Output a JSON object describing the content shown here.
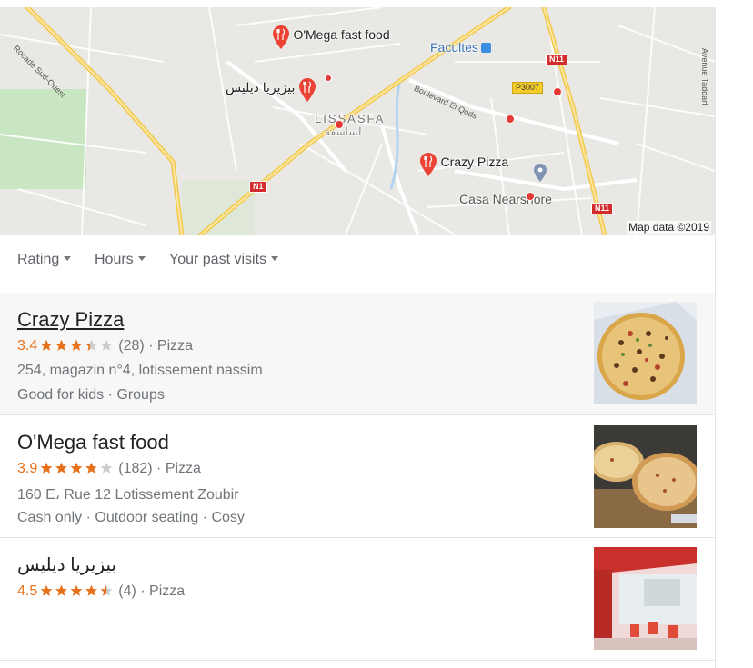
{
  "map": {
    "places": [
      {
        "name": "O'Mega fast food"
      },
      {
        "name": "بيزيريا ديليس"
      },
      {
        "name": "Crazy Pizza"
      }
    ],
    "labels": {
      "facultes": "Facultes",
      "lissasfa": "LISSASFA",
      "lissasfa_ar": "لساسفة",
      "casa_nearshore": "Casa Nearshore",
      "rocade": "Rocade Sud-Ouest",
      "boulevard": "Boulevard El Qods",
      "avenue": "Avenue Taddart"
    },
    "road_shields": {
      "n11_a": "N11",
      "n11_b": "N11",
      "n1": "N1",
      "p3007": "P3007"
    },
    "credit": "Map data ©2019",
    "colors": {
      "pin": "#ea4335",
      "major_road": "#f9d24e",
      "water": "#b3d3f0",
      "park": "#c8e6c1"
    }
  },
  "filters": [
    {
      "label": "Rating"
    },
    {
      "label": "Hours"
    },
    {
      "label": "Your past visits"
    }
  ],
  "results": [
    {
      "name": "Crazy Pizza",
      "rating": "3.4",
      "stars": 3.4,
      "reviews": "(28)",
      "category": "Pizza",
      "address": "254, magazin n°4, lotissement nassim",
      "attributes": "Good for kids · Groups",
      "thumb": "pizza-box-photo"
    },
    {
      "name": "O'Mega fast food",
      "rating": "3.9",
      "stars": 3.9,
      "reviews": "(182)",
      "category": "Pizza",
      "address": "160 E، Rue 12 Lotissement Zoubir",
      "attributes": "Cash only · Outdoor seating · Cosy",
      "thumb": "pizzas-on-board-photo"
    },
    {
      "name": "بيزيريا ديليس",
      "rating": "4.5",
      "stars": 4.5,
      "reviews": "(4)",
      "category": "Pizza",
      "address": "",
      "attributes": "",
      "thumb": "restaurant-terrace-photo"
    }
  ],
  "separator": " · ",
  "colors": {
    "rating": "#e7711b",
    "star_empty": "#cccccc",
    "text_secondary": "#70757a"
  }
}
